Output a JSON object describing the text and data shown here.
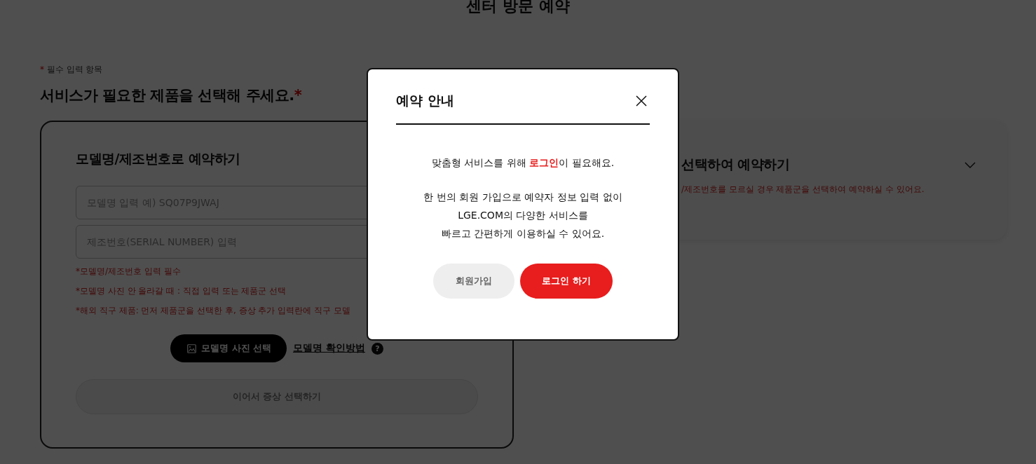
{
  "page_title": "센터 방문 예약",
  "required_note": {
    "mark": "*",
    "text": "필수 입력 항목"
  },
  "heading": {
    "text": "서비스가 필요한 제품을 선택해 주세요.",
    "mark": "*"
  },
  "model_card": {
    "title": "모델명/제조번호로 예약하기",
    "fields": [
      {
        "placeholder": "모델명 입력 예) SQ07P9JWAJ"
      },
      {
        "placeholder": "제조번호(SERIAL NUMBER) 입력"
      }
    ],
    "notes": [
      "*모델명/제조번호 입력 필수",
      "*모델명 사진 안 올라갈 때 : 직접 입력 또는 제품군 선택",
      "*해외 직구 제품: 먼저 제품군을 선택한 후, 증상 추가 입력란에 직구 모델"
    ],
    "photo_button": "모델명 사진 선택",
    "help_link": "모델명 확인방법",
    "help_icon": "?",
    "next_button": "이어서 증상 선택하기"
  },
  "category_card": {
    "title": "선택하여 예약하기",
    "description": "/제조번호를 모르실 경우 제품군을 선택하여 예약하실 수 있어요."
  },
  "modal": {
    "title": "예약 안내",
    "lead": {
      "before": "맞춤형 서비스를 위해 ",
      "highlight": "로그인",
      "after": "이 필요해요."
    },
    "lines": [
      "한 번의 회원 가입으로 예약자 정보 입력 없이",
      "LGE.COM의 다양한 서비스를",
      "빠르고 간편하게 이용하실 수 있어요."
    ],
    "buttons": [
      {
        "label": "회원가입",
        "kind": "secondary"
      },
      {
        "label": "로그인 하기",
        "kind": "primary"
      }
    ]
  }
}
